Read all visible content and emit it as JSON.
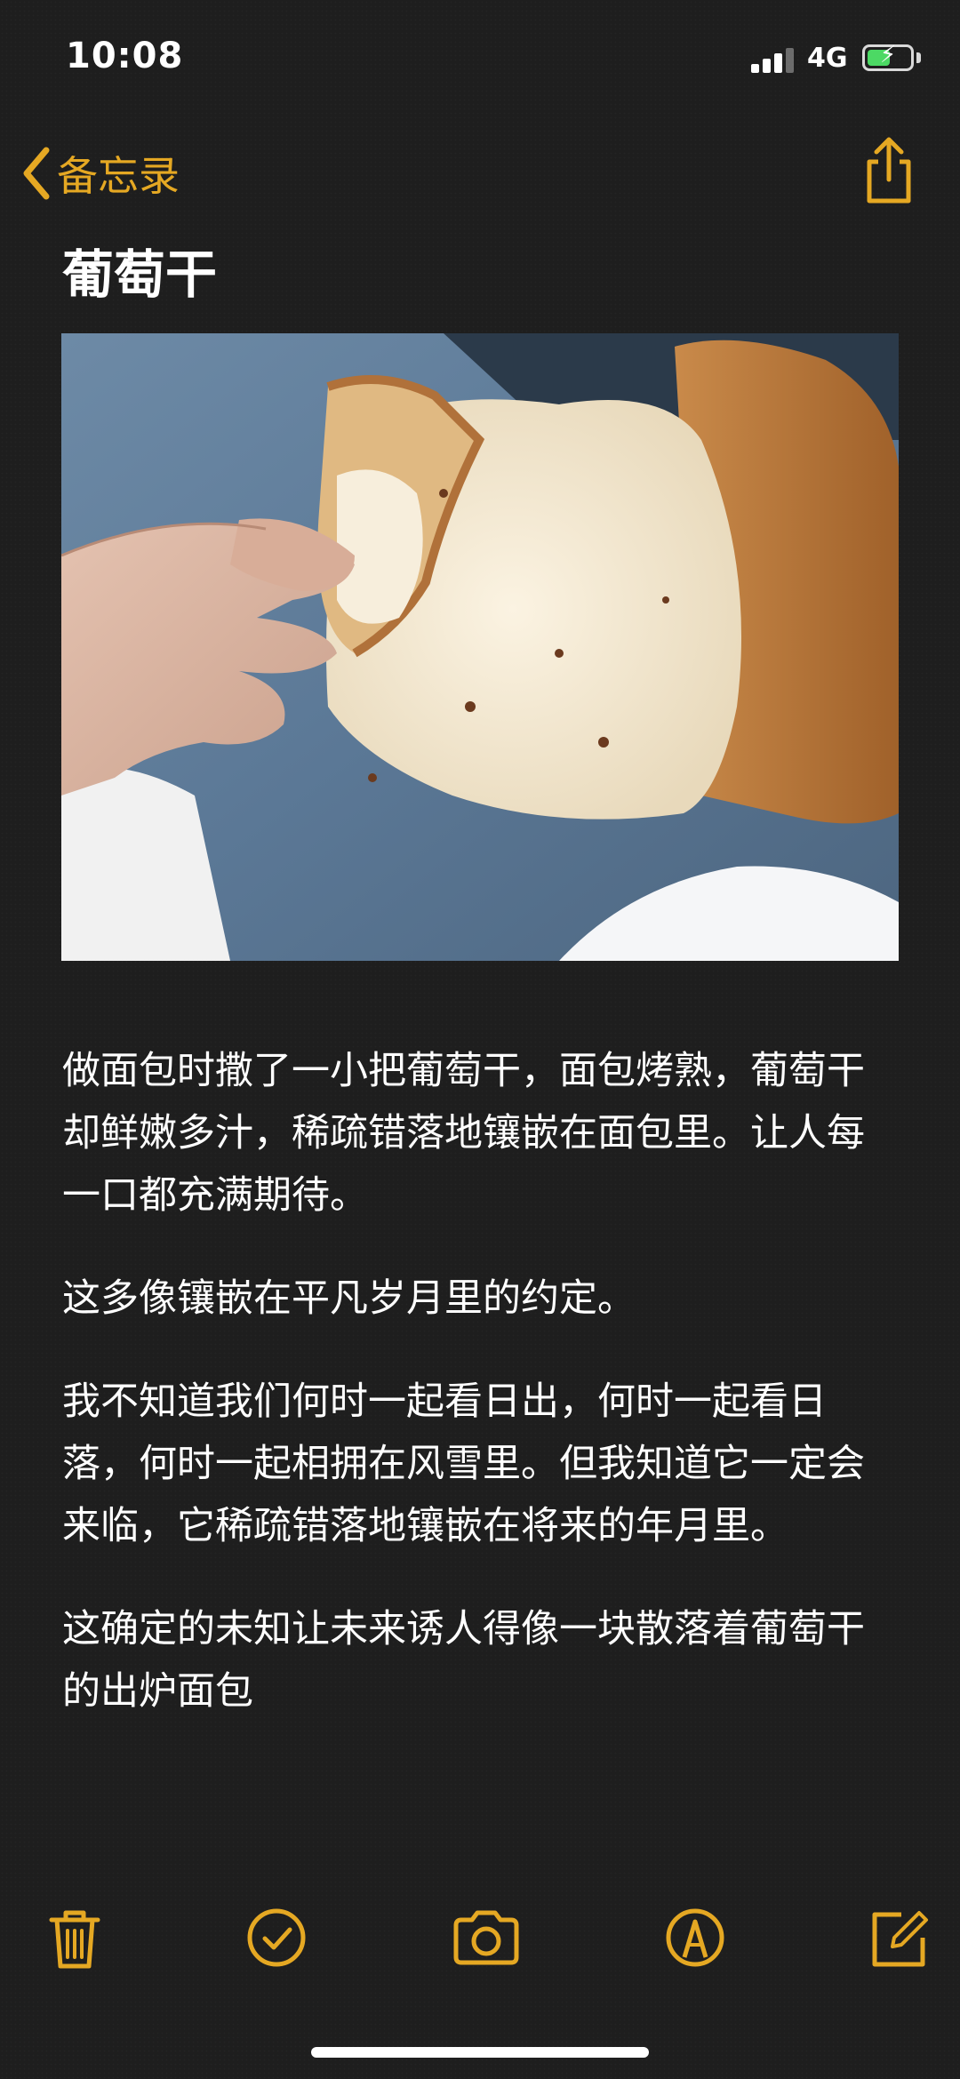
{
  "status_bar": {
    "time": "10:08",
    "network": "4G",
    "battery_level": 0.6
  },
  "nav": {
    "back_label": "备忘录",
    "accent_color": "#e5a823"
  },
  "note": {
    "title": "葡萄干",
    "paragraphs": [
      "做面包时撒了一小把葡萄干，面包烤熟，葡萄干却鲜嫩多汁，稀疏错落地镶嵌在面包里。让人每一口都充满期待。",
      "这多像镶嵌在平凡岁月里的约定。",
      "我不知道我们何时一起看日出，何时一起看日落，何时一起相拥在风雪里。但我知道它一定会来临，它稀疏错落地镶嵌在将来的年月里。",
      "这确定的未知让未来诱人得像一块散落着葡萄干的出炉面包"
    ]
  },
  "toolbar": {
    "icons": [
      "trash-icon",
      "checklist-icon",
      "camera-icon",
      "markup-icon",
      "compose-icon"
    ]
  }
}
